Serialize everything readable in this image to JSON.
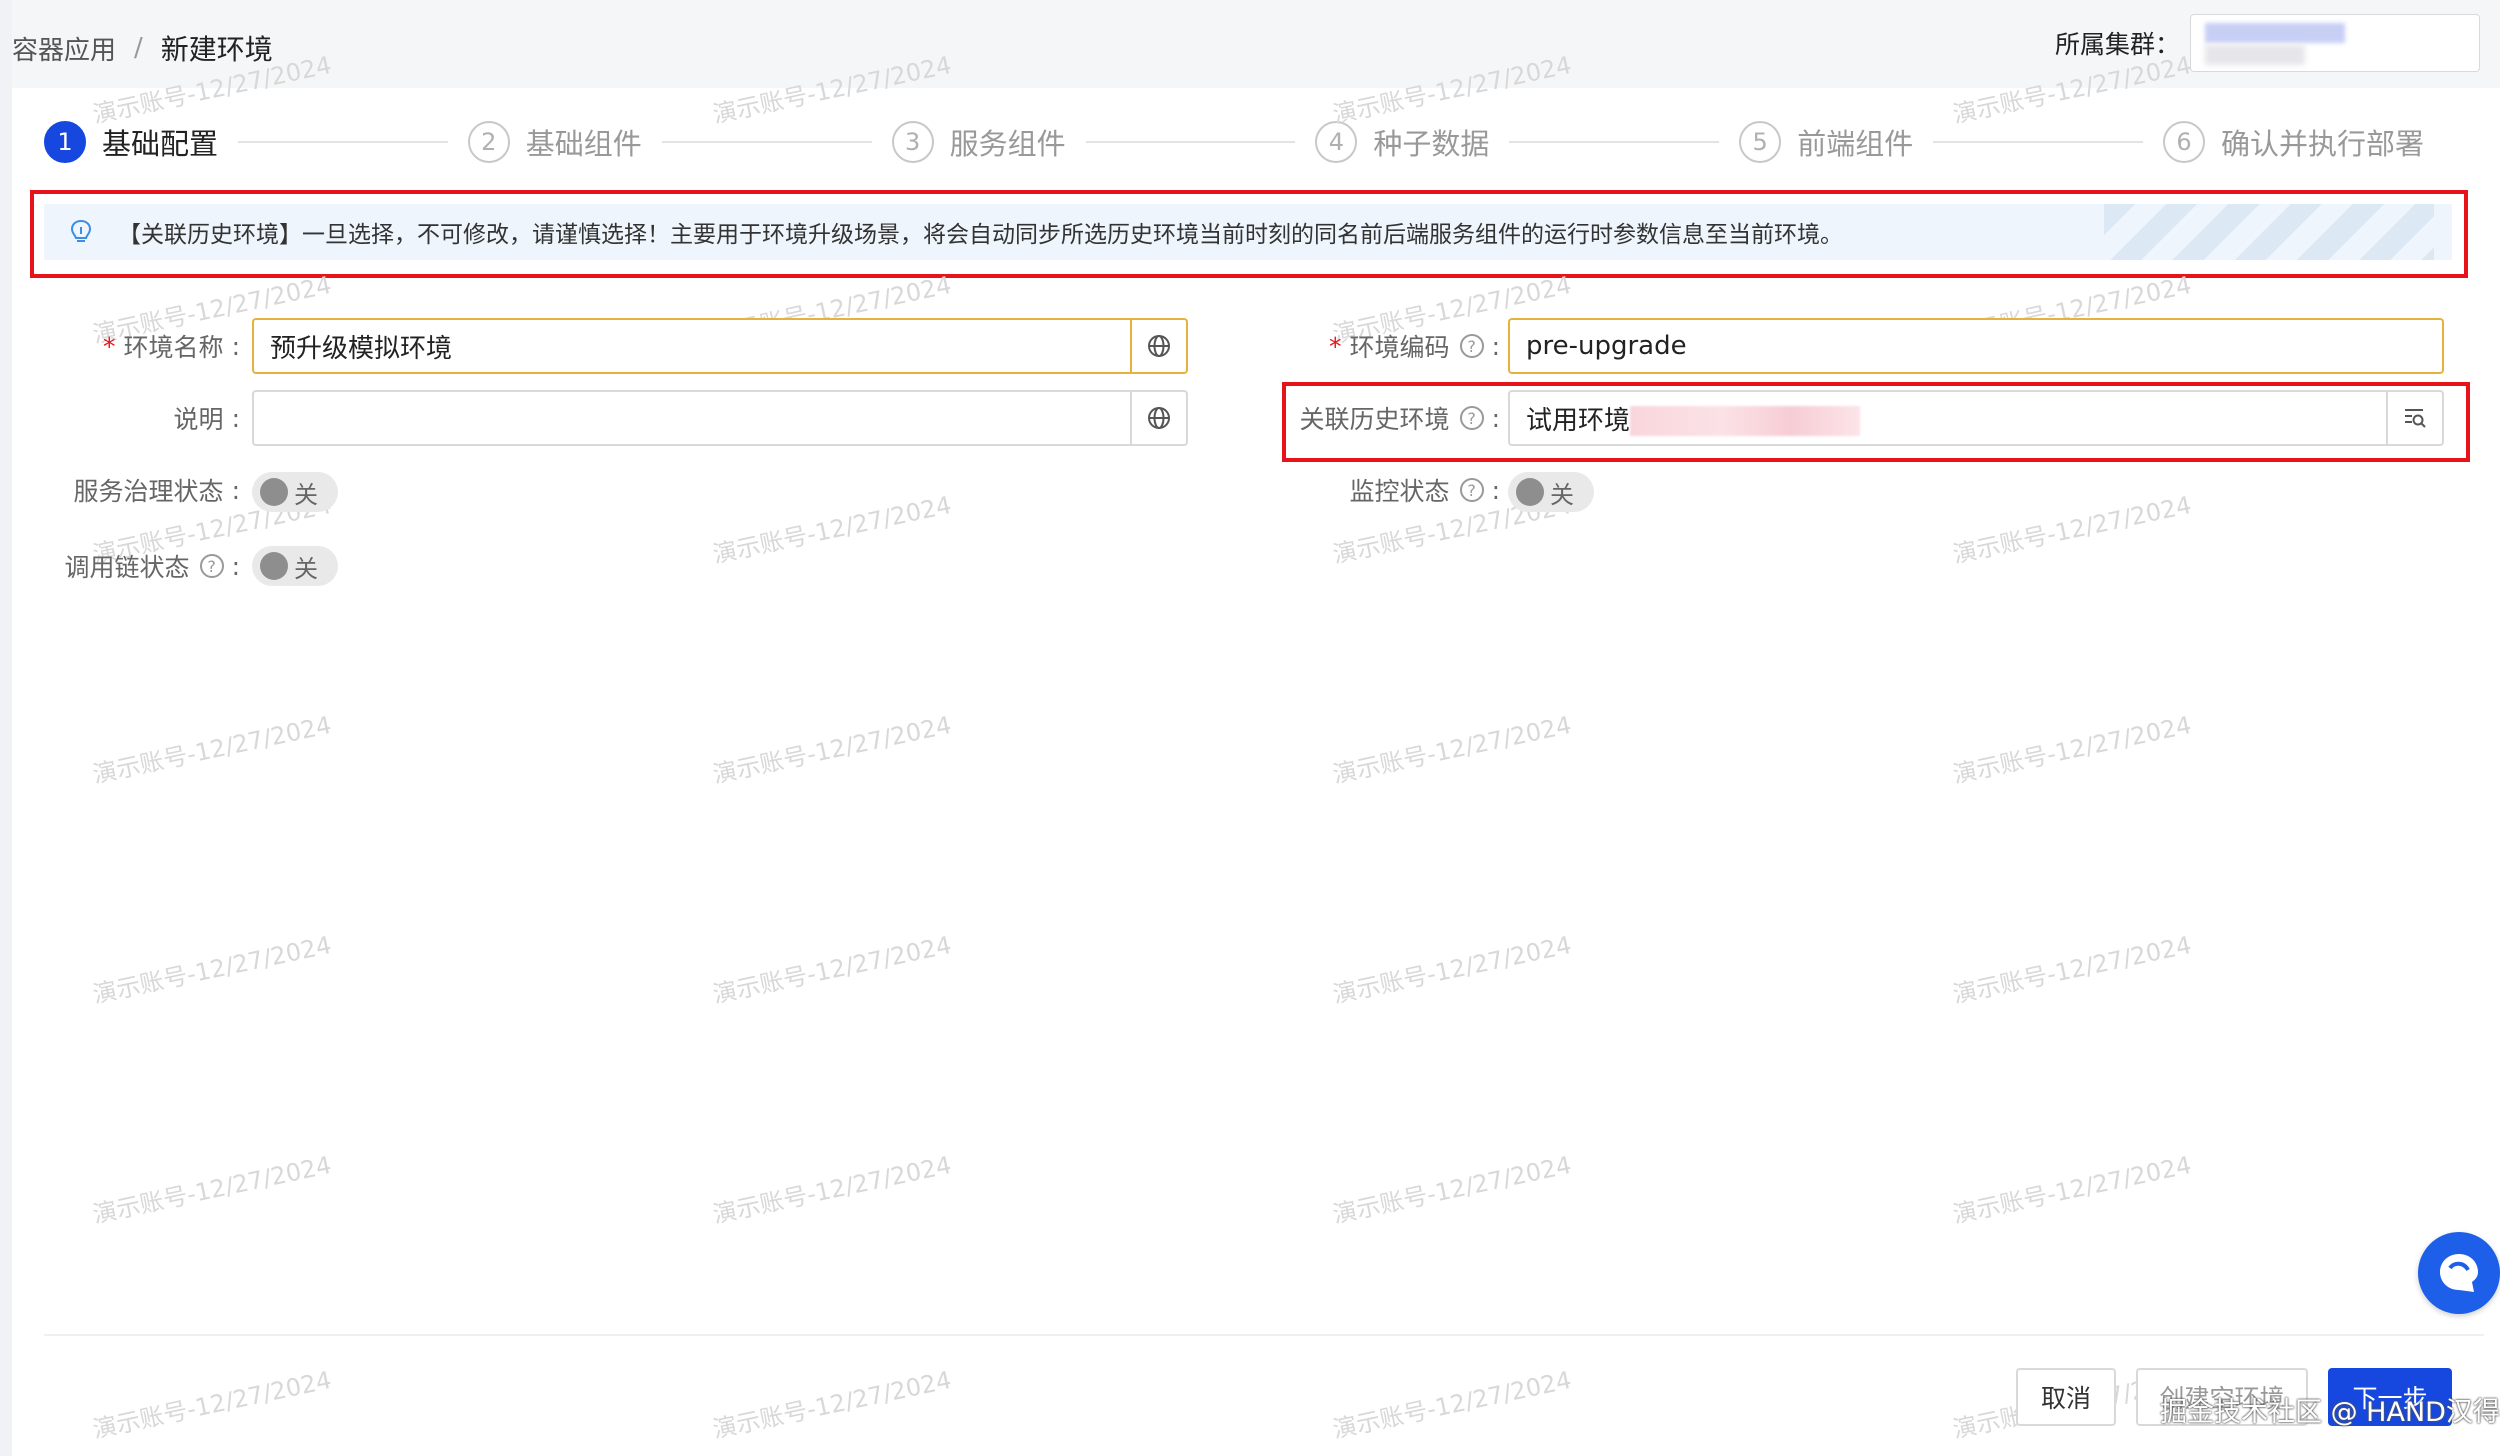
{
  "breadcrumb": {
    "parent": "容器应用",
    "separator": "/",
    "current": "新建环境"
  },
  "cluster": {
    "label": "所属集群："
  },
  "steps": [
    {
      "num": "1",
      "title": "基础配置",
      "active": true
    },
    {
      "num": "2",
      "title": "基础组件"
    },
    {
      "num": "3",
      "title": "服务组件"
    },
    {
      "num": "4",
      "title": "种子数据"
    },
    {
      "num": "5",
      "title": "前端组件"
    },
    {
      "num": "6",
      "title": "确认并执行部署"
    }
  ],
  "notice": {
    "icon": "lightbulb-icon",
    "text": "【关联历史环境】一旦选择，不可修改，请谨慎选择！主要用于环境升级场景，将会自动同步所选历史环境当前时刻的同名前后端服务组件的运行时参数信息至当前环境。"
  },
  "form": {
    "env_name": {
      "label": "环境名称",
      "value": "预升级模拟环境",
      "required": true
    },
    "description": {
      "label": "说明",
      "value": ""
    },
    "service_governance": {
      "label": "服务治理状态",
      "toggle_text": "关"
    },
    "call_chain": {
      "label": "调用链状态",
      "toggle_text": "关"
    },
    "env_code": {
      "label": "环境编码",
      "value": "pre-upgrade",
      "required": true
    },
    "related_env": {
      "label": "关联历史环境",
      "value": "试用环境"
    },
    "monitor": {
      "label": "监控状态",
      "toggle_text": "关"
    },
    "colon": ":",
    "help_glyph": "?",
    "required_mark": "*"
  },
  "watermark": "演示账号-12/27/2024",
  "footer": {
    "cancel": "取消",
    "create_empty": "创建空环境",
    "next": "下一步",
    "credit": "掘金技术社区 @ HAND汉得"
  },
  "colors": {
    "primary": "#1648e0",
    "highlight_border": "#e8131a",
    "warning_border": "#e5b33c",
    "notice_bg": "#eef5fc"
  }
}
